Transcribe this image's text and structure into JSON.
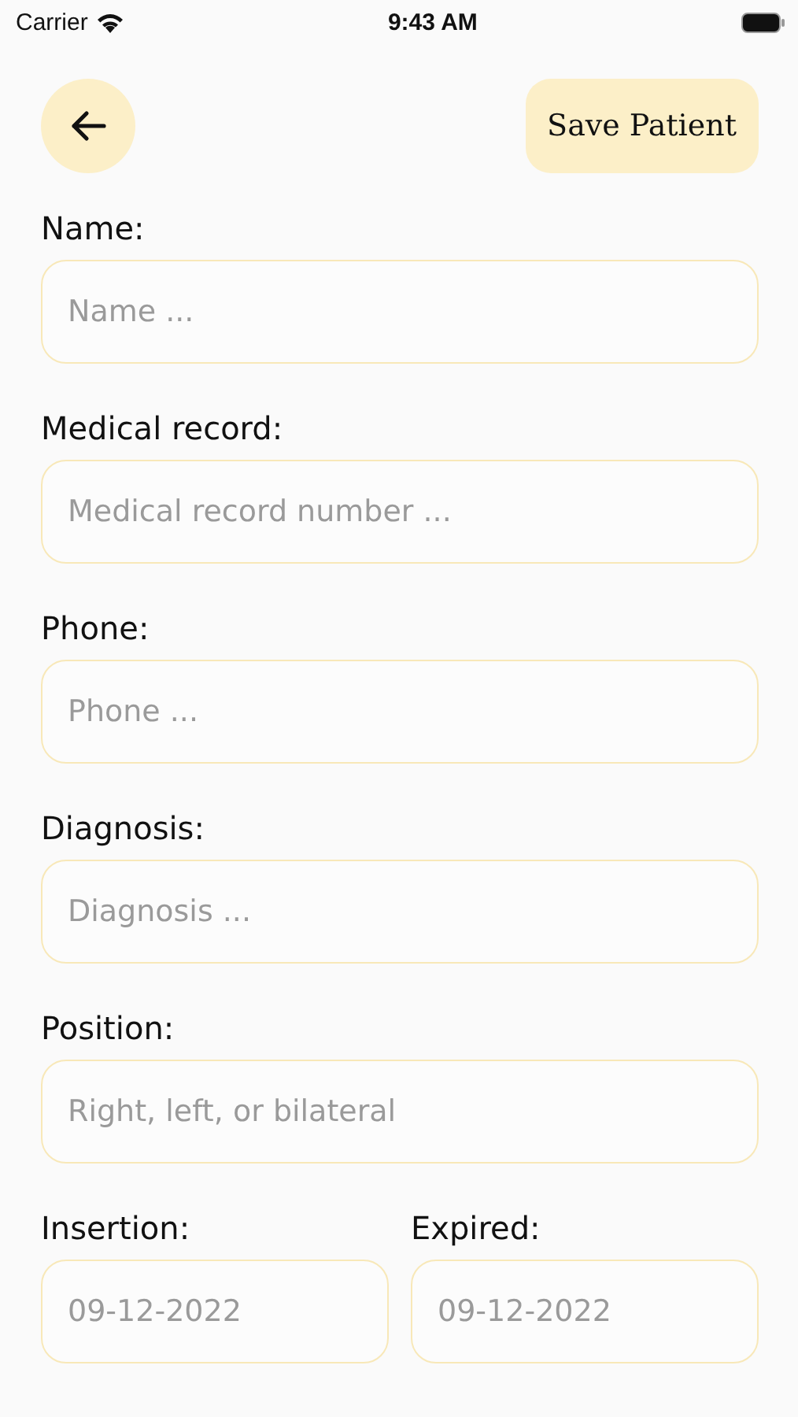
{
  "status_bar": {
    "carrier": "Carrier",
    "time": "9:43 AM"
  },
  "header": {
    "save_button": "Save Patient"
  },
  "fields": [
    {
      "label": "Name:",
      "placeholder": "Name ..."
    },
    {
      "label": "Medical record:",
      "placeholder": "Medical record number ..."
    },
    {
      "label": "Phone:",
      "placeholder": "Phone ..."
    },
    {
      "label": "Diagnosis:",
      "placeholder": "Diagnosis ..."
    },
    {
      "label": "Position:",
      "placeholder": "Right, left, or bilateral"
    }
  ],
  "date_fields": [
    {
      "label": "Insertion:",
      "placeholder": "09-12-2022"
    },
    {
      "label": "Expired:",
      "placeholder": "09-12-2022"
    }
  ]
}
